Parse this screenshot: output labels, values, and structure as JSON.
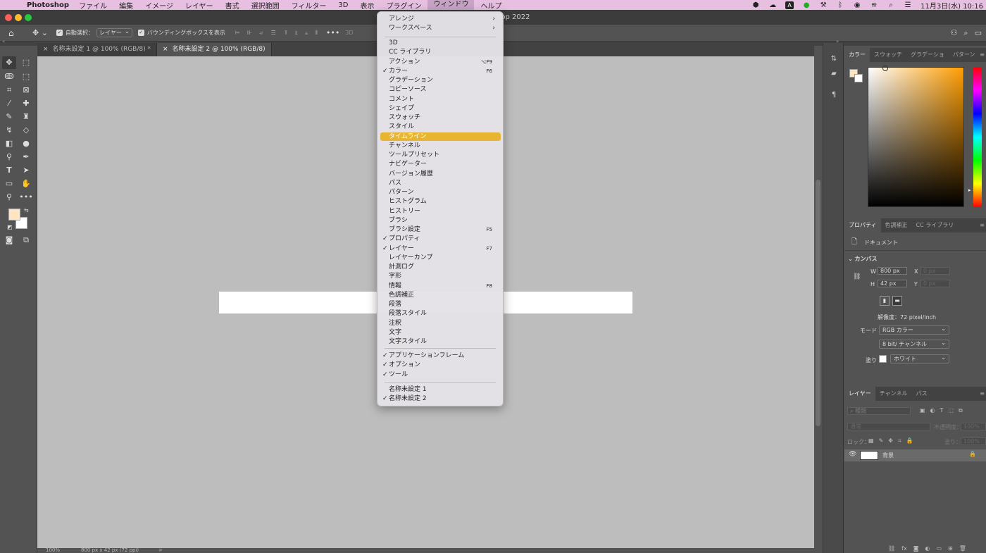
{
  "menubar": {
    "app_name": "Photoshop",
    "items": [
      "ファイル",
      "編集",
      "イメージ",
      "レイヤー",
      "書式",
      "選択範囲",
      "フィルター",
      "3D",
      "表示",
      "プラグイン",
      "ウィンドウ",
      "ヘルプ"
    ],
    "active_item": "ウィンドウ",
    "clock": "11月3日(水) 10:16",
    "status_letter": "A"
  },
  "titlebar": {
    "title": "hop 2022"
  },
  "options": {
    "auto_select_label": "自動選択：",
    "auto_select_value": "レイヤー",
    "bbox_label": "バウンディングボックスを表示",
    "mode_3d": "3D"
  },
  "tabs": [
    {
      "label": "名称未設定 1 @ 100% (RGB/8) *",
      "close": "×"
    },
    {
      "label": "名称未設定 2 @ 100% (RGB/8)",
      "close": "×"
    }
  ],
  "status": {
    "zoom": "100%",
    "doc_info": "800 px x 42 px (72 ppi)",
    "arrow": ">"
  },
  "window_menu": {
    "group1": [
      {
        "label": "アレンジ",
        "submenu": true
      },
      {
        "label": "ワークスペース",
        "submenu": true
      }
    ],
    "group2": [
      {
        "label": "3D"
      },
      {
        "label": "CC ライブラリ"
      },
      {
        "label": "アクション",
        "shortcut": "⌥F9"
      },
      {
        "label": "カラー",
        "checked": true,
        "shortcut": "F6"
      },
      {
        "label": "グラデーション"
      },
      {
        "label": "コピーソース"
      },
      {
        "label": "コメント"
      },
      {
        "label": "シェイプ"
      },
      {
        "label": "スウォッチ"
      },
      {
        "label": "スタイル"
      },
      {
        "label": "タイムライン",
        "highlighted": true
      },
      {
        "label": "チャンネル"
      },
      {
        "label": "ツールプリセット"
      },
      {
        "label": "ナビゲーター"
      },
      {
        "label": "バージョン履歴"
      },
      {
        "label": "パス"
      },
      {
        "label": "パターン"
      },
      {
        "label": "ヒストグラム"
      },
      {
        "label": "ヒストリー"
      },
      {
        "label": "ブラシ"
      },
      {
        "label": "ブラシ設定",
        "shortcut": "F5"
      },
      {
        "label": "プロパティ",
        "checked": true
      },
      {
        "label": "レイヤー",
        "checked": true,
        "shortcut": "F7"
      },
      {
        "label": "レイヤーカンプ"
      },
      {
        "label": "計測ログ"
      },
      {
        "label": "字形"
      },
      {
        "label": "情報",
        "shortcut": "F8"
      },
      {
        "label": "色調補正"
      },
      {
        "label": "段落"
      },
      {
        "label": "段落スタイル"
      },
      {
        "label": "注釈"
      },
      {
        "label": "文字"
      },
      {
        "label": "文字スタイル"
      }
    ],
    "group3": [
      {
        "label": "アプリケーションフレーム",
        "checked": true
      },
      {
        "label": "オプション",
        "checked": true
      },
      {
        "label": "ツール",
        "checked": true
      }
    ],
    "group4": [
      {
        "label": "名称未設定 1"
      },
      {
        "label": "名称未設定 2",
        "checked": true
      }
    ]
  },
  "color_panel": {
    "tabs": [
      "カラー",
      "スウォッチ",
      "グラデーショ",
      "パターン"
    ],
    "foreground": "#fde5c2",
    "background": "#ffffff"
  },
  "properties_panel": {
    "tabs": [
      "プロパティ",
      "色調補正",
      "CC ライブラリ"
    ],
    "doc_label": "ドキュメント",
    "section": "カンバス",
    "w_label": "W",
    "w_value": "800 px",
    "h_label": "H",
    "h_value": "42 px",
    "x_label": "X",
    "x_value": "0 px",
    "y_label": "Y",
    "y_value": "0 px",
    "resolution": "解像度：72 pixel/inch",
    "mode_label": "モード",
    "mode_value": "RGB カラー",
    "depth_value": "8 bit/ チャンネル",
    "fill_label": "塗り",
    "fill_value": "ホワイト"
  },
  "layers_panel": {
    "tabs": [
      "レイヤー",
      "チャンネル",
      "パス"
    ],
    "search_placeholder": "種類",
    "blend_mode": "通常",
    "opacity_label": "不透明度：",
    "opacity_value": "100%",
    "lock_label": "ロック：",
    "fill_label": "塗り：",
    "fill_value": "100%",
    "layers": [
      {
        "name": "背景"
      }
    ]
  }
}
